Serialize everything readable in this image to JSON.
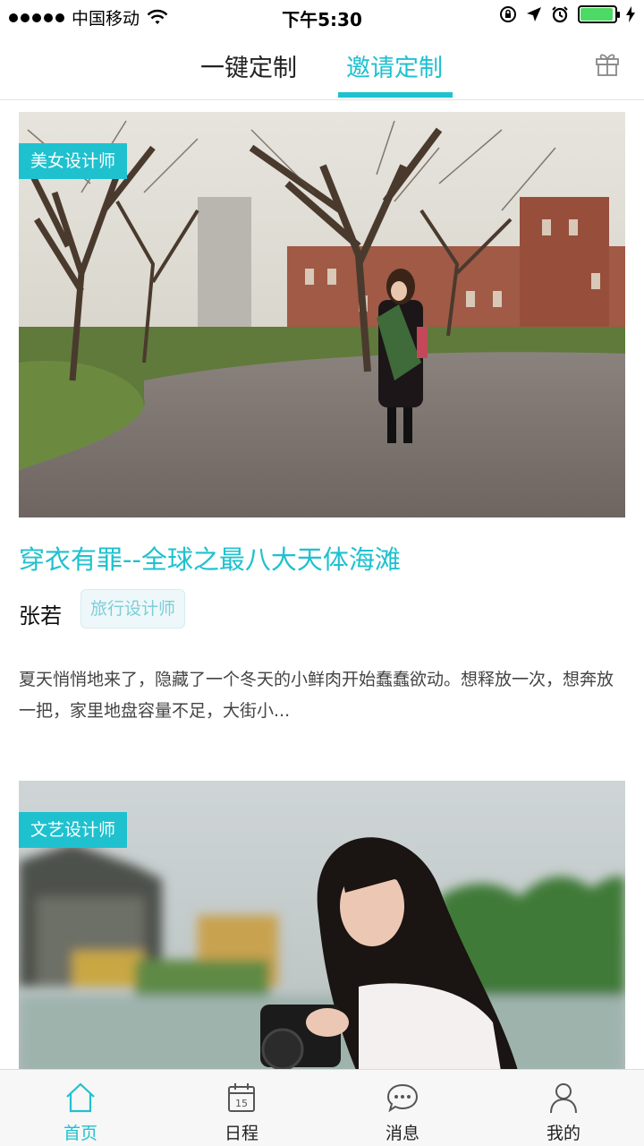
{
  "status_bar": {
    "carrier": "中国移动",
    "time": "下午5:30",
    "battery_level": 0.95
  },
  "tabs": [
    {
      "label": "一键定制",
      "active": false
    },
    {
      "label": "邀请定制",
      "active": true
    }
  ],
  "accent_color": "#1fc1cf",
  "cards": [
    {
      "badge": "美女设计师",
      "title": "穿衣有罪--全球之最八大天体海滩",
      "author": "张若",
      "tag": "旅行设计师",
      "description": "夏天悄悄地来了，隐藏了一个冬天的小鲜肉开始蠢蠢欲动。想释放一次，想奔放一把，家里地盘容量不足，大街小..."
    },
    {
      "badge": "文艺设计师"
    }
  ],
  "bottom_nav": [
    {
      "label": "首页",
      "icon": "home-icon",
      "active": true
    },
    {
      "label": "日程",
      "icon": "calendar-icon",
      "active": false,
      "calendar_day": "15"
    },
    {
      "label": "消息",
      "icon": "message-icon",
      "active": false
    },
    {
      "label": "我的",
      "icon": "profile-icon",
      "active": false
    }
  ]
}
